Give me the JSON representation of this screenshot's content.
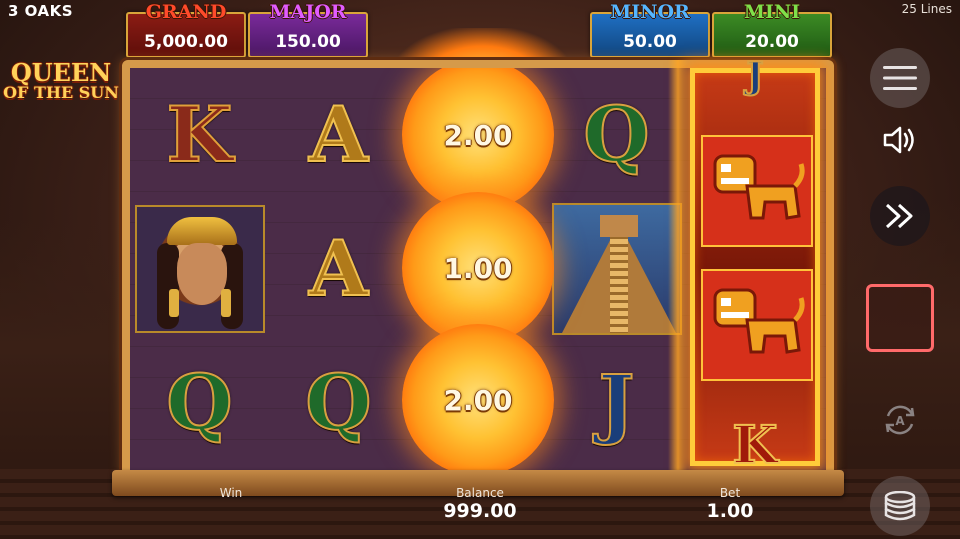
{
  "header": {
    "brand": "3 OAKS",
    "lines": "25 Lines"
  },
  "jackpots": {
    "grand": {
      "name": "GRAND",
      "value": "5,000.00",
      "color": "#ff4a2a"
    },
    "major": {
      "name": "MAJOR",
      "value": "150.00",
      "color": "#e15cff"
    },
    "minor": {
      "name": "MINOR",
      "value": "50.00",
      "color": "#55b6ff"
    },
    "mini": {
      "name": "MINI",
      "value": "20.00",
      "color": "#7fe04a"
    }
  },
  "logo": {
    "line1": "QUEEN",
    "line2": "OF THE SUN"
  },
  "reels": {
    "col1": [
      "K",
      "queen",
      "Q"
    ],
    "col2": [
      "A",
      "A",
      "Q"
    ],
    "col3": [
      "sun",
      "sun",
      "sun"
    ],
    "col4": [
      "Q",
      "pyramid",
      "J"
    ],
    "col5": [
      "J",
      "jaguar",
      "jaguar",
      "K"
    ]
  },
  "sun_values": [
    "2.00",
    "1.00",
    "2.00"
  ],
  "letters": {
    "r1c1": "K",
    "r1c2": "A",
    "r1c4": "Q",
    "r2c2": "A",
    "r3c1": "Q",
    "r3c2": "Q",
    "r3c4": "J",
    "hot_top": "J",
    "hot_bottom": "K"
  },
  "bottom": {
    "win_label": "Win",
    "balance_label": "Balance",
    "balance_value": "999.00",
    "bet_label": "Bet",
    "bet_value": "1.00"
  },
  "controls": {
    "menu_icon": "hamburger-menu-icon",
    "sound_icon": "speaker-icon",
    "turbo_icon": "fast-forward-icon",
    "spin_icon": "stop-square-icon",
    "auto_icon": "autoplay-icon",
    "bet_icon": "coin-stack-icon"
  }
}
